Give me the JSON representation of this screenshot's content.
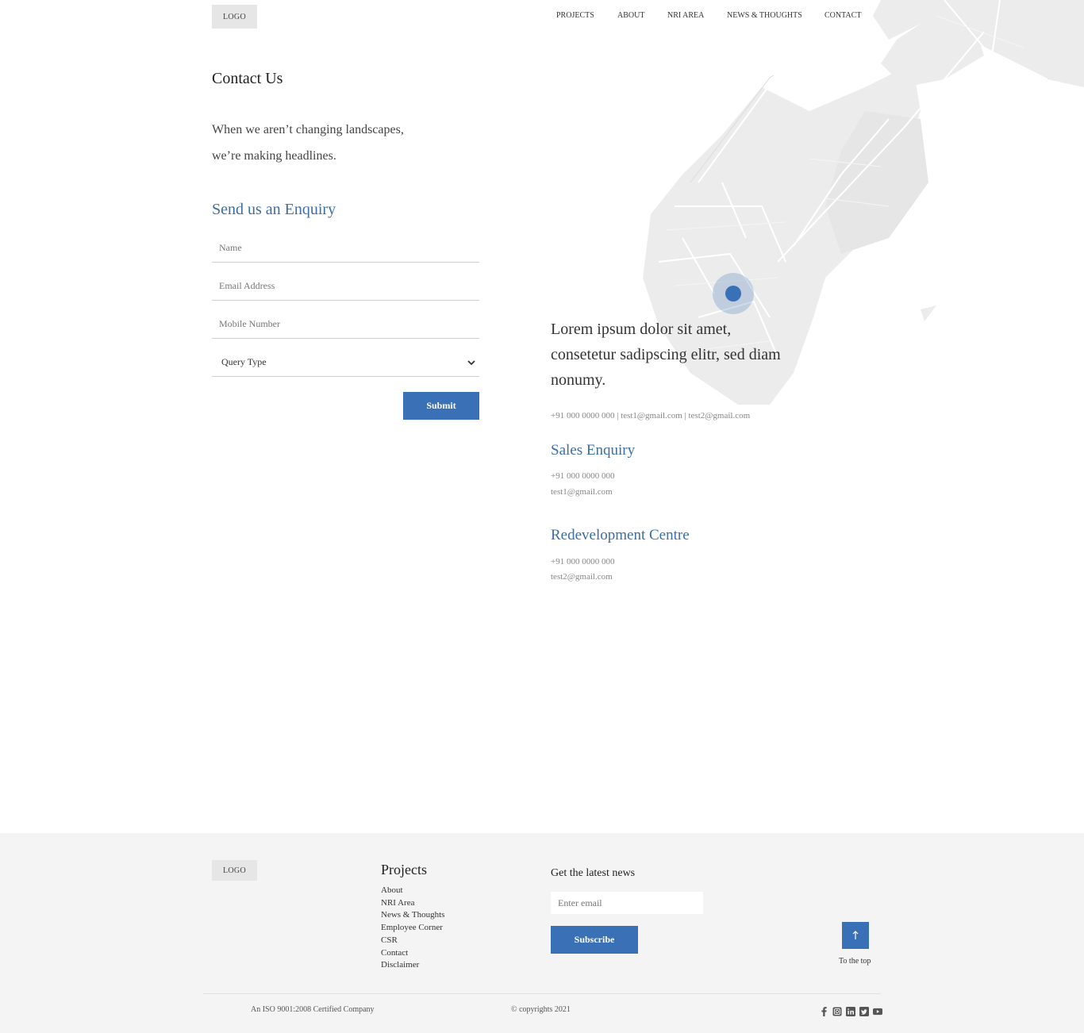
{
  "header": {
    "logo": "LOGO",
    "nav": [
      "PROJECTS",
      "ABOUT",
      "NRI AREA",
      "NEWS & THOUGHTS",
      "CONTACT"
    ]
  },
  "page": {
    "title": "Contact Us",
    "tagline_line1": "When we aren’t changing landscapes,",
    "tagline_line2": "we’re making headlines."
  },
  "form": {
    "title": "Send us an Enquiry",
    "name_placeholder": "Name",
    "email_placeholder": "Email Address",
    "mobile_placeholder": "Mobile Number",
    "query_type": "Query Type",
    "submit": "Submit"
  },
  "info": {
    "lead": "Lorem ipsum dolor sit amet, consetetur sadipscing elitr, sed diam nonumy.",
    "contact_line": "+91 000 0000 000 | test1@gmail.com | test2@gmail.com",
    "sales": {
      "title": "Sales Enquiry",
      "phone": "+91 000 0000 000",
      "email": "test1@gmail.com"
    },
    "redevelopment": {
      "title": "Redevelopment Centre",
      "phone": "+91 000 0000 000",
      "email": "test2@gmail.com"
    }
  },
  "footer": {
    "logo": "LOGO",
    "projects_title": "Projects",
    "links": [
      "About",
      "NRI Area",
      "News & Thoughts",
      "Employee Corner",
      "CSR",
      "Contact",
      "Disclaimer"
    ],
    "news_title": "Get the latest news",
    "email_placeholder": "Enter email",
    "subscribe": "Subscribe",
    "to_top": "To the top",
    "iso": "An ISO 9001:2008 Certified Company",
    "copyright": "© copyrights 2021",
    "social_icons": [
      "facebook-icon",
      "instagram-icon",
      "linkedin-icon",
      "twitter-icon",
      "youtube-icon"
    ]
  },
  "colors": {
    "accent": "#3a70b5",
    "heading_blue": "#3a6ea5",
    "footer_bg": "#f4f4f4",
    "map_land": "#ececec"
  }
}
